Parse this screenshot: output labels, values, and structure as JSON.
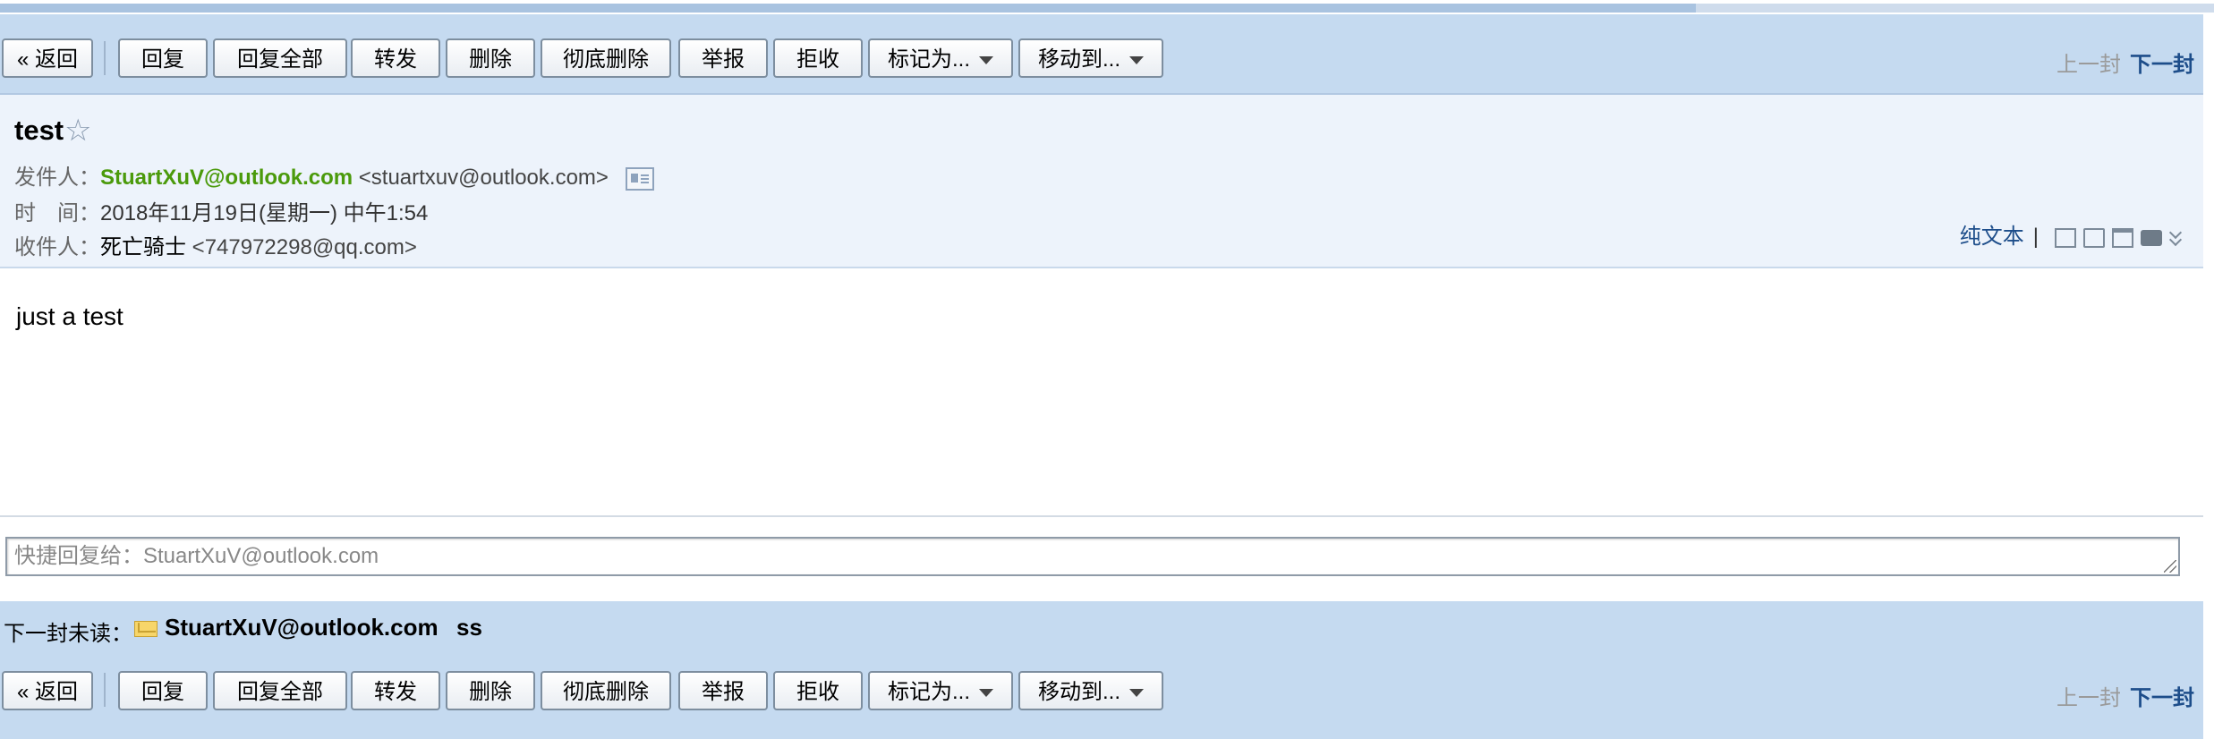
{
  "toolbar": {
    "back": "« 返回",
    "reply": "回复",
    "reply_all": "回复全部",
    "forward": "转发",
    "delete": "删除",
    "delete_permanent": "彻底删除",
    "report": "举报",
    "reject": "拒收",
    "mark_as": "标记为...",
    "move_to": "移动到...",
    "prev": "上一封",
    "next": "下一封"
  },
  "mail": {
    "subject": "test",
    "star": "☆",
    "from_label": "发件人：",
    "from_name": "StuartXuV@outlook.com",
    "from_addr": "<stuartxuv@outlook.com>",
    "time_label": "时　间：",
    "time_value": "2018年11月19日(星期一) 中午1:54",
    "to_label": "收件人：",
    "to_name": "死亡骑士",
    "to_addr": "<747972298@qq.com>",
    "plain_text": "纯文本",
    "tools_sep": "|",
    "body": "just a test"
  },
  "icons": [
    "contact-card-icon",
    "new-window-icon",
    "note-icon",
    "save-icon",
    "print-icon",
    "expand-more-icon",
    "envelope-icon",
    "dropdown-caret-icon"
  ],
  "quick_reply": {
    "placeholder": "快捷回复给：StuartXuV@outlook.com"
  },
  "next_unread": {
    "label": "下一封未读：",
    "sender": "StuartXuV@outlook.com",
    "subject": "ss"
  },
  "colors": {
    "toolbar_bg": "#c5daf0",
    "header_bg": "#edf3fb",
    "sender_green": "#4b9a0b",
    "link_blue": "#1d4d8a"
  }
}
